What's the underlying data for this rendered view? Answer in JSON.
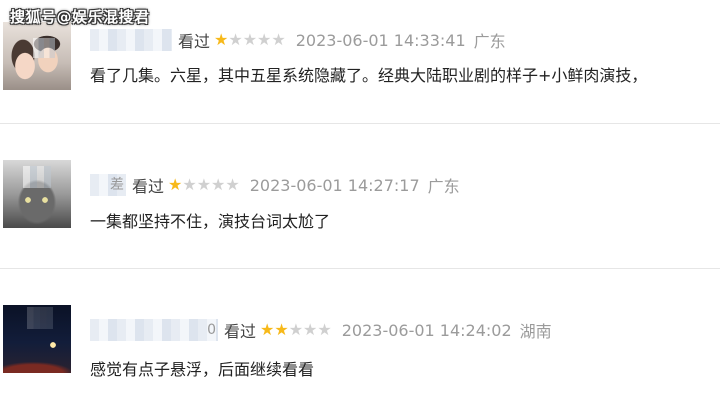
{
  "watermark": "搜狐号@娱乐混搜君",
  "icons": {
    "star_filled": "★",
    "star_empty": "★"
  },
  "colors": {
    "star_on": "#f7b91a",
    "star_off": "#d0d0d0"
  },
  "comments": [
    {
      "username_visible": "",
      "watched_label": "看过",
      "rating": 1,
      "max_rating": 5,
      "timestamp": "2023-06-01 14:33:41",
      "region": "广东",
      "text": "看了几集。六星，其中五星系统隐藏了。经典大陆职业剧的样子+小鲜肉演技，"
    },
    {
      "username_visible": "差",
      "watched_label": "看过",
      "rating": 1,
      "max_rating": 5,
      "timestamp": "2023-06-01 14:27:17",
      "region": "广东",
      "text": "一集都坚持不住，演技台词太尬了"
    },
    {
      "username_visible": "0",
      "watched_label": "看过",
      "rating": 2,
      "max_rating": 5,
      "timestamp": "2023-06-01 14:24:02",
      "region": "湖南",
      "text": "感觉有点子悬浮，后面继续看看"
    }
  ]
}
